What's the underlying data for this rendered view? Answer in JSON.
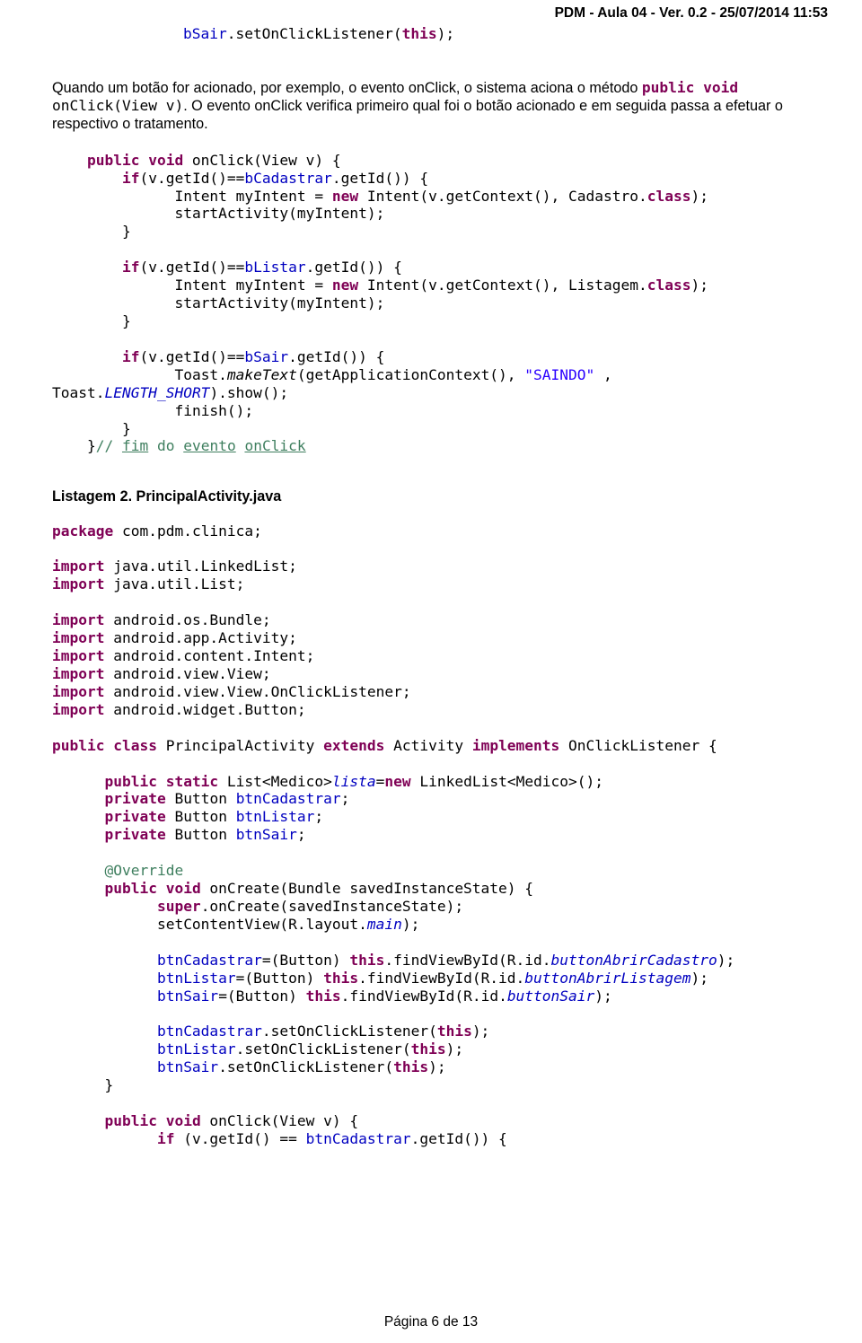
{
  "header": "PDM - Aula 04 - Ver. 0.2 - 25/07/2014 11:53",
  "line_top": {
    "pre": "bSair",
    "mid": ".setOnClickListener(",
    "kw": "this",
    "end": ");"
  },
  "para1a": "Quando um botão for acionado, por exemplo, o evento onClick, o sistema aciona o método ",
  "para1b_kw": "public void",
  "para1c": "onClick(View v)",
  "para1d": ". O evento onClick verifica primeiro qual foi o botão acionado e em seguida passa a efetuar o respectivo  o tratamento.",
  "b1": {
    "l1_kw": "public void",
    "l1_rest": " onClick(View v) {",
    "l2_kw": "if",
    "l2_a": "(v.getId()==",
    "l2_b": "bCadastrar",
    "l2_c": ".getId()) {",
    "l3_a": "Intent myIntent = ",
    "l3_kw": "new",
    "l3_b": " Intent(v.getContext(), Cadastro.",
    "l3_c": "class",
    "l3_d": ");",
    "l4": "startActivity(myIntent);",
    "l5": "}"
  },
  "b2": {
    "l1_kw": "if",
    "l1_a": "(v.getId()==",
    "l1_b": "bListar",
    "l1_c": ".getId()) {",
    "l2_a": "Intent myIntent = ",
    "l2_kw": "new",
    "l2_b": " Intent(v.getContext(), Listagem.",
    "l2_c": "class",
    "l2_d": ");",
    "l3": "startActivity(myIntent);",
    "l4": "}"
  },
  "b3": {
    "l1_kw": "if",
    "l1_a": "(v.getId()==",
    "l1_b": "bSair",
    "l1_c": ".getId()) {",
    "l2_a": "Toast.",
    "l2_b": "makeText",
    "l2_c": "(getApplicationContext(), ",
    "l2_str": "\"SAINDO\"",
    "l2_d": " ,",
    "l3_a": "Toast.",
    "l3_b": "LENGTH_SHORT",
    "l3_c": ").show();",
    "l4": "finish();",
    "l5": "}",
    "l6a": "}",
    "l6b": "// ",
    "l6c": "fim",
    "l6d": " do ",
    "l6e": "evento",
    "l6f": " ",
    "l6g": "onClick"
  },
  "heading": "Listagem 2. PrincipalActivity.java",
  "pkg_kw": "package",
  "pkg": " com.pdm.clinica;",
  "imp_kw": "import",
  "imp1": " java.util.LinkedList;",
  "imp2": " java.util.List;",
  "imp3": " android.os.Bundle;",
  "imp4": " android.app.Activity;",
  "imp5": " android.content.Intent;",
  "imp6": " android.view.View;",
  "imp7": " android.view.View.OnClickListener;",
  "imp8": " android.widget.Button;",
  "cls": {
    "a": "public class",
    "b": " PrincipalActivity ",
    "c": "extends",
    "d": " Activity ",
    "e": "implements",
    "f": " OnClickListener {"
  },
  "f1": {
    "a": "public static",
    "b": " List<Medico>",
    "c": "lista",
    "d": "=",
    "e": "new",
    "f": " LinkedList<Medico>();"
  },
  "f2": {
    "a": "private",
    "b": " Button ",
    "c": "btnCadastrar",
    "d": ";"
  },
  "f3": {
    "a": "private",
    "b": " Button ",
    "c": "btnListar",
    "d": ";"
  },
  "f4": {
    "a": "private",
    "b": " Button ",
    "c": "btnSair",
    "d": ";"
  },
  "ov": "@Override",
  "oc": {
    "a": "public void",
    "b": " onCreate(Bundle savedInstanceState) {"
  },
  "sup": {
    "a": "super",
    "b": ".onCreate(savedInstanceState);"
  },
  "scv": {
    "a": "setContentView(R.layout.",
    "b": "main",
    "c": ");"
  },
  "fv1": {
    "a": "btnCadastrar",
    "b": "=(Button) ",
    "c": "this",
    "d": ".findViewById(R.id.",
    "e": "buttonAbrirCadastro",
    "f": ");"
  },
  "fv2": {
    "a": "btnListar",
    "b": "=(Button) ",
    "c": "this",
    "d": ".findViewById(R.id.",
    "e": "buttonAbrirListagem",
    "f": ");"
  },
  "fv3": {
    "a": "btnSair",
    "b": "=(Button) ",
    "c": "this",
    "d": ".findViewById(R.id.",
    "e": "buttonSair",
    "f": ");"
  },
  "sc1": {
    "a": "btnCadastrar",
    "b": ".setOnClickListener(",
    "c": "this",
    "d": ");"
  },
  "sc2": {
    "a": "btnListar",
    "b": ".setOnClickListener(",
    "c": "this",
    "d": ");"
  },
  "sc3": {
    "a": "btnSair",
    "b": ".setOnClickListener(",
    "c": "this",
    "d": ");"
  },
  "cb": "}",
  "ock": {
    "a": "public void",
    "b": " onClick(View v) {"
  },
  "ifl": {
    "a": "if",
    "b": " (v.getId() == ",
    "c": "btnCadastrar",
    "d": ".getId()) {"
  },
  "footer": "Página 6 de 13"
}
